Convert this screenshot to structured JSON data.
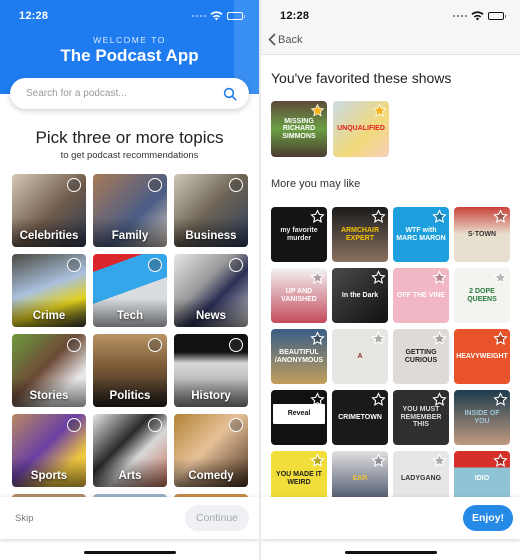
{
  "left": {
    "status": {
      "time": "12:28"
    },
    "header": {
      "welcome": "WELCOME TO",
      "title": "The Podcast App",
      "color": "#1e7cf0"
    },
    "search": {
      "placeholder": "Search for a podcast...",
      "icon": "search-icon"
    },
    "heading": "Pick three or more topics",
    "subheading": "to get podcast recommendations",
    "topics": [
      {
        "label": "Celebrities",
        "selected": false,
        "bg": "linear-gradient(135deg,#d7c8b4,#6e5a4a 55%,#2f3d55)"
      },
      {
        "label": "Family",
        "selected": false,
        "bg": "linear-gradient(135deg,#a77a58,#4a5d85 60%,#e0d0c0)"
      },
      {
        "label": "Business",
        "selected": false,
        "bg": "linear-gradient(135deg,#cfc8b6,#6b6254 50%,#2c3d5c)"
      },
      {
        "label": "Crime",
        "selected": false,
        "bg": "linear-gradient(160deg,#4a4a40,#a9c0de 45%,#e3d21c 70%,#3a3a30)"
      },
      {
        "label": "Tech",
        "selected": false,
        "bg": "linear-gradient(160deg,#d8262a 0 18%,#35a6ea 18% 50%,#d9dde2 50%)"
      },
      {
        "label": "News",
        "selected": false,
        "bg": "linear-gradient(135deg,#e6e6e6,#9a9a9a 40%,#2b2f55 60%,#cfcfcf)"
      },
      {
        "label": "Stories",
        "selected": false,
        "bg": "linear-gradient(135deg,#6d9a3e,#6d4a36 45%,#e8e8ea 75%)"
      },
      {
        "label": "Politics",
        "selected": false,
        "bg": "linear-gradient(180deg,#b89464,#7b5a36 45%,#2b2420)"
      },
      {
        "label": "History",
        "selected": false,
        "bg": "linear-gradient(180deg,#111 0 25%,#d8d8d8 40%,#8f8f8f)"
      },
      {
        "label": "Sports",
        "selected": false,
        "bg": "linear-gradient(135deg,#b98a63,#6a3fa4 45%,#f0c640 75%)"
      },
      {
        "label": "Arts",
        "selected": false,
        "bg": "linear-gradient(135deg,#e6e6e6,#2a2a2a 40%,#d9d9d9 60%,#c46f56)"
      },
      {
        "label": "Comedy",
        "selected": false,
        "bg": "linear-gradient(135deg,#b28238,#e6c098 45%,#4a3220)"
      }
    ],
    "footer": {
      "skip": "Skip",
      "continue": "Continue"
    }
  },
  "right": {
    "status": {
      "time": "12:28"
    },
    "nav": {
      "back": "Back"
    },
    "favorited_title": "You've favorited these shows",
    "favorites": [
      {
        "title": "Missing Richard Simmons",
        "art_text": "MISSING\n\nRICHARD SIMMONS",
        "bg": "linear-gradient(180deg,#5e4a3c,#6aa043 50%,#4a3a30)",
        "fg": "#fff",
        "favorited": true
      },
      {
        "title": "Unqualified",
        "art_text": "UNQUALIFIED",
        "bg": "linear-gradient(135deg,#c9dbe6,#f2d97a 60%,#f3d0b8)",
        "fg": "#d22",
        "favorited": true
      }
    ],
    "more_title": "More you may like",
    "shows": [
      {
        "title": "My Favorite Murder",
        "art_text": "my favorite murder",
        "bg": "#141414",
        "fg": "#e8e8e8"
      },
      {
        "title": "Armchair Expert",
        "art_text": "ARMCHAIR EXPERT",
        "bg": "linear-gradient(180deg,#1b1b1b,#8a7160)",
        "fg": "#f2c200"
      },
      {
        "title": "WTF with Marc Maron",
        "art_text": "WTF with MARC MARON",
        "bg": "#1c9fdc",
        "fg": "#fff"
      },
      {
        "title": "S-Town",
        "art_text": "S·TOWN",
        "bg": "linear-gradient(180deg,#c9423a,#e8e0cf 50%)",
        "fg": "#333"
      },
      {
        "title": "Up and Vanished",
        "art_text": "UP AND VANISHED",
        "bg": "linear-gradient(180deg,#f3f3f3,#c44a5c)",
        "fg": "#fff"
      },
      {
        "title": "In the Dark",
        "art_text": "In the Dark",
        "bg": "linear-gradient(135deg,#4a4a4a,#111)",
        "fg": "#fff"
      },
      {
        "title": "Off the Vine",
        "art_text": "OFF THE VINE",
        "bg": "#f1b7c4",
        "fg": "#fff"
      },
      {
        "title": "2 Dope Queens",
        "art_text": "2 DOPE QUEENS",
        "bg": "#f3f3f0",
        "fg": "#2a7a3a"
      },
      {
        "title": "Beautiful / Anonymous",
        "art_text": "BEAUTIFUL /ANONYMOUS",
        "bg": "linear-gradient(180deg,#3a5e86,#c29f5c)",
        "fg": "#fff"
      },
      {
        "title": "A",
        "art_text": "A",
        "bg": "#e8e6e2",
        "fg": "#a03030"
      },
      {
        "title": "Getting Curious",
        "art_text": "GETTING CURIOUS",
        "bg": "#dedad5",
        "fg": "#222"
      },
      {
        "title": "Heavyweight",
        "art_text": "HEAVYWEIGHT",
        "bg": "#e8532a",
        "fg": "#fff"
      },
      {
        "title": "Reveal",
        "art_text": "Reveal",
        "bg": "#111",
        "fg": "#111"
      },
      {
        "title": "Crimetown",
        "art_text": "CRIMETOWN",
        "bg": "#1a1a1a",
        "fg": "#fff"
      },
      {
        "title": "You Must Remember This",
        "art_text": "YOU MUST REMEMBER THIS",
        "bg": "#2f2f2f",
        "fg": "#ddd"
      },
      {
        "title": "Inside of You",
        "art_text": "INSIDE OF YOU",
        "bg": "linear-gradient(180deg,#1e3c4e,#c09a80)",
        "fg": "#9fc6d6"
      },
      {
        "title": "You Made It Weird",
        "art_text": "YOU MADE IT WEIRD",
        "bg": "#f2de3a",
        "fg": "#222"
      },
      {
        "title": "Ear Hustle",
        "art_text": "EAR",
        "bg": "linear-gradient(180deg,#e0e0e0,#3b4660)",
        "fg": "#f0c23a"
      },
      {
        "title": "Ladygang",
        "art_text": "LADYGANG",
        "bg": "#e6e6e8",
        "fg": "#333"
      },
      {
        "title": "Idiotica",
        "art_text": "IDIO",
        "bg": "linear-gradient(180deg,#d7302b 0 30%,#8fc4d6 30%)",
        "fg": "#fff"
      }
    ],
    "footer": {
      "enjoy": "Enjoy!",
      "accent": "#2589e6"
    }
  }
}
